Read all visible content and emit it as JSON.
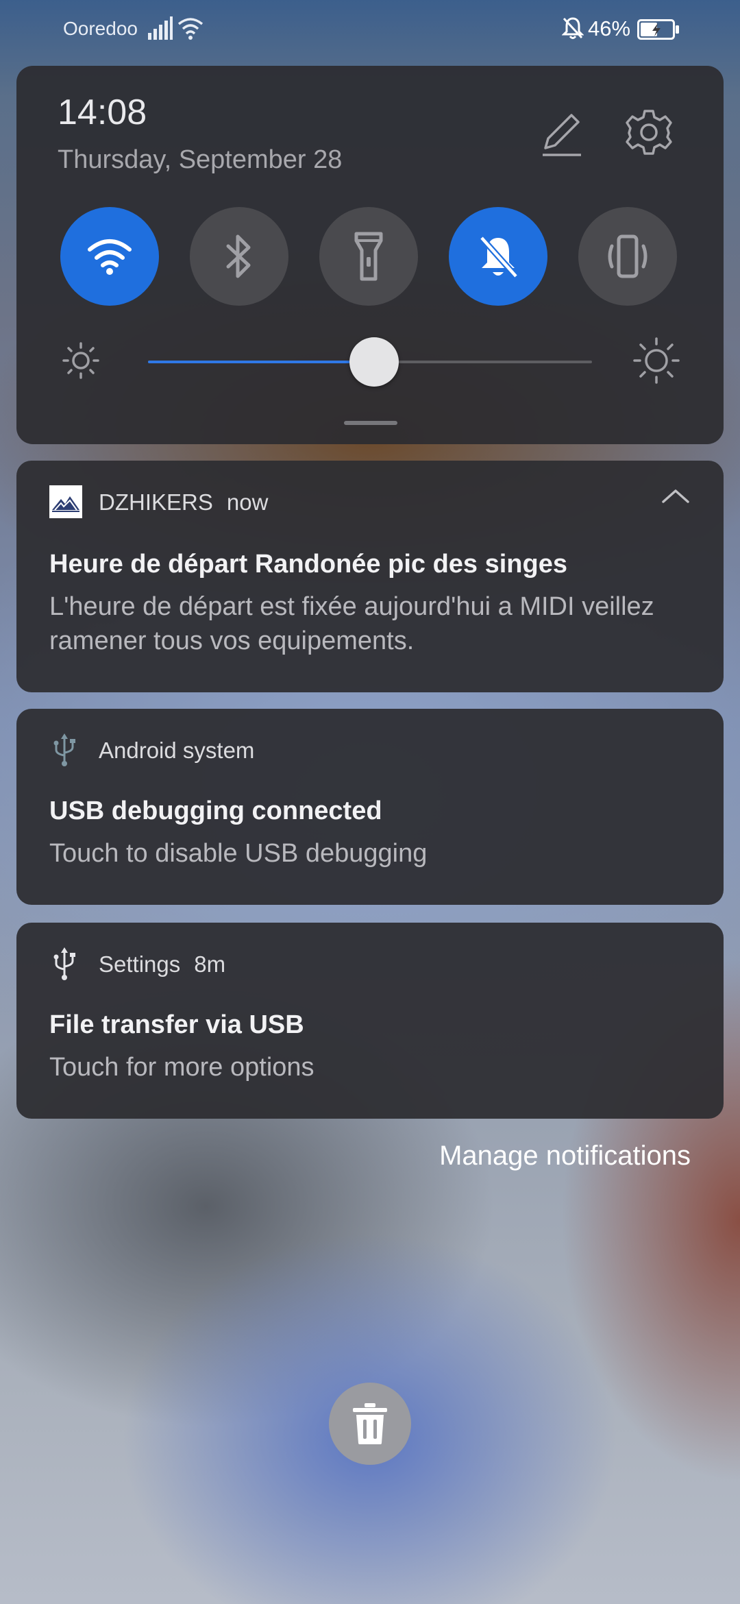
{
  "status_bar": {
    "carrier": "Ooredoo",
    "battery_percent": "46%",
    "icons": [
      "signal-icon",
      "wifi-icon",
      "bell-off-icon",
      "battery-charging-icon"
    ]
  },
  "quick_settings": {
    "time": "14:08",
    "date": "Thursday, September 28",
    "toggles": [
      {
        "name": "wifi",
        "icon": "wifi-icon",
        "on": true
      },
      {
        "name": "bluetooth",
        "icon": "bluetooth-icon",
        "on": false
      },
      {
        "name": "flashlight",
        "icon": "flashlight-icon",
        "on": false
      },
      {
        "name": "silent",
        "icon": "bell-off-icon",
        "on": true
      },
      {
        "name": "vibrate",
        "icon": "vibrate-icon",
        "on": false
      }
    ],
    "brightness": 0.51,
    "accent_color": "#1f6fde"
  },
  "notifications": [
    {
      "app": "DZHIKERS",
      "time": "now",
      "title": "Heure de départ Randonée pic des singes",
      "body": "L'heure de départ est fixée aujourd'hui a MIDI veillez ramener tous vos equipements.",
      "icon": "mountain-logo-icon"
    },
    {
      "app": "Android system",
      "time": "",
      "title": "USB debugging connected",
      "body": "Touch to disable USB debugging",
      "icon": "usb-icon"
    },
    {
      "app": "Settings",
      "time": "8m",
      "title": "File transfer via USB",
      "body": "Touch for more options",
      "icon": "usb-icon"
    }
  ],
  "manage_label": "Manage notifications"
}
